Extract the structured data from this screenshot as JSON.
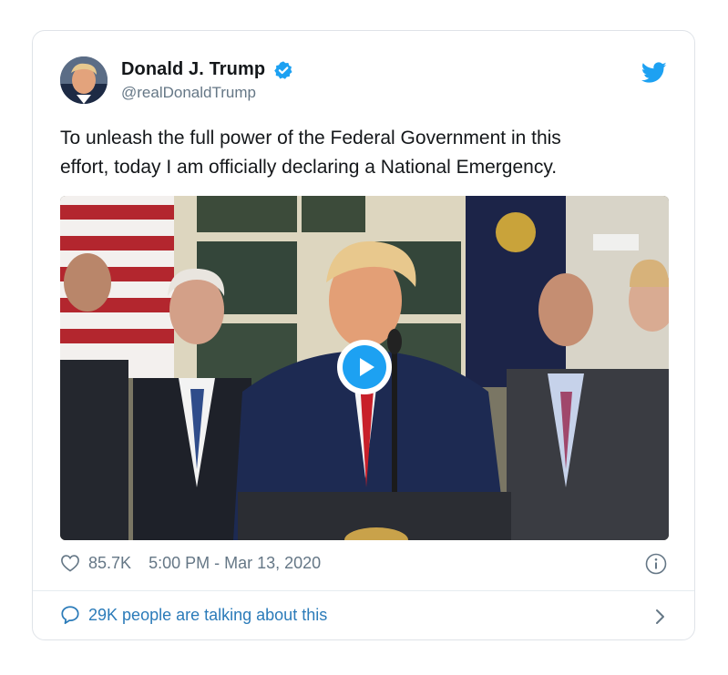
{
  "user": {
    "display_name": "Donald J. Trump",
    "handle": "@realDonaldTrump",
    "verified": true
  },
  "tweet": {
    "text_line1": "To unleash the full power of the Federal Government in this",
    "text_line2": "effort, today I am officially declaring a National Emergency."
  },
  "meta": {
    "likes": "85.7K",
    "timestamp": "5:00 PM - Mar 13, 2020"
  },
  "footer": {
    "talking": "29K people are talking about this"
  },
  "icons": {
    "brand": "twitter-bird-icon",
    "verified": "verified-badge-icon",
    "like": "heart-icon",
    "info": "info-icon",
    "reply": "speech-bubble-icon",
    "more": "chevron-right-icon",
    "play": "play-icon"
  },
  "colors": {
    "twitter_blue": "#1da1f2",
    "link_blue": "#2b7bb9",
    "text_primary": "#14171a",
    "text_secondary": "#657786"
  }
}
